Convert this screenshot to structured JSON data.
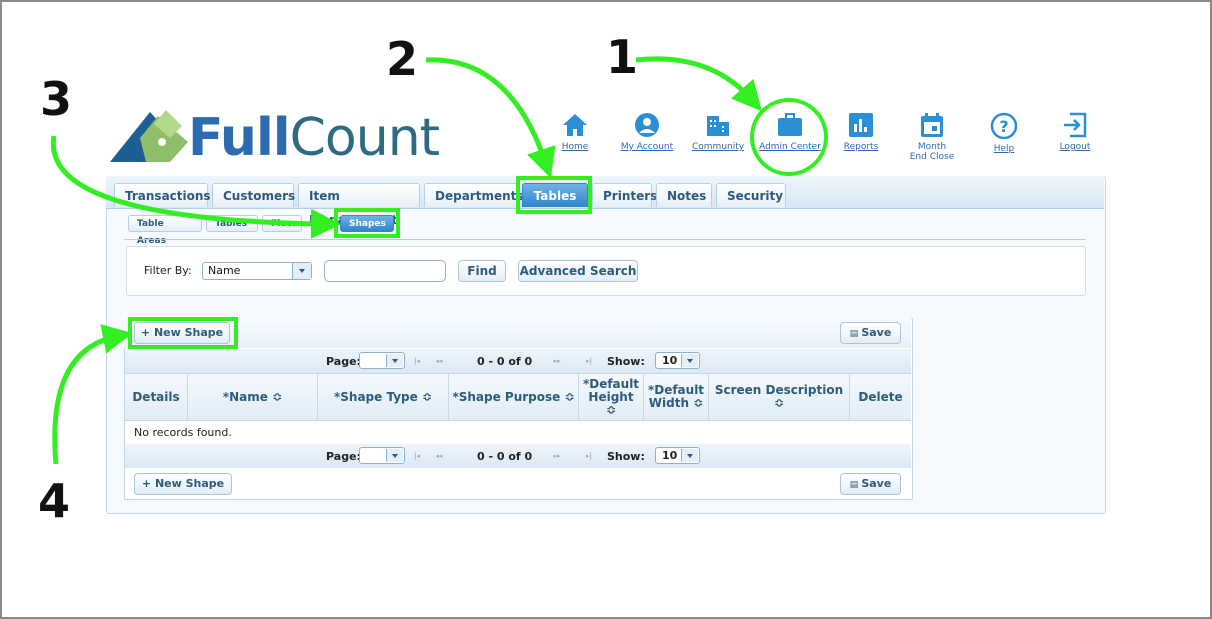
{
  "logo": {
    "part1": "Full",
    "part2": "Count"
  },
  "nav": [
    {
      "label": "Home",
      "icon": "home-icon"
    },
    {
      "label": "My Account",
      "icon": "account-icon"
    },
    {
      "label": "Community",
      "icon": "community-icon"
    },
    {
      "label": "Admin Center",
      "icon": "briefcase-icon"
    },
    {
      "label": "Reports",
      "icon": "reports-icon"
    },
    {
      "label": "Month End Close",
      "icon": "calendar-icon"
    },
    {
      "label": "Help",
      "icon": "help-icon"
    },
    {
      "label": "Logout",
      "icon": "logout-icon"
    }
  ],
  "tabs": [
    "Transactions",
    "Customers",
    "Item Management",
    "Departments",
    "Tables",
    "Printers",
    "Notes",
    "Security"
  ],
  "active_tab": "Tables",
  "subtabs": [
    "Table Areas",
    "Tables",
    "Floor",
    "Shapes"
  ],
  "active_subtab": "Shapes",
  "filter": {
    "label": "Filter By:",
    "selected": "Name",
    "value": "",
    "find": "Find",
    "advanced": "Advanced Search"
  },
  "grid": {
    "new_button": "New Shape",
    "save_button": "Save",
    "page_label": "Page:",
    "range": "0 - 0 of 0",
    "show_label": "Show:",
    "show_value": "10",
    "columns": [
      "Details",
      "*Name ≎",
      "*Shape Type ≎",
      "*Shape Purpose ≎",
      "*Default Height ≎",
      "*Default Width ≎",
      "Screen Description ≎",
      "Delete"
    ],
    "empty": "No records found."
  },
  "annotations": [
    "1",
    "2",
    "3",
    "4"
  ],
  "colors": {
    "highlight": "#33ee22",
    "accent": "#2f86cc"
  }
}
